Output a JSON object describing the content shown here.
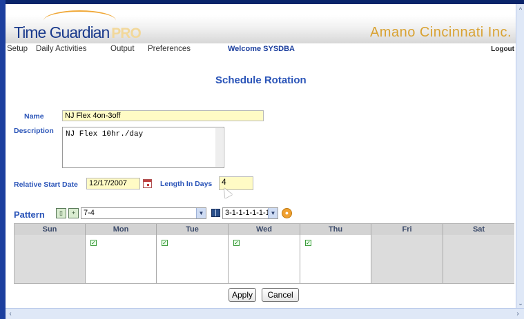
{
  "app": {
    "logo_text": "Time Guardian",
    "logo_suffix": "PRO",
    "company": "Amano Cincinnati Inc."
  },
  "menu": {
    "items": [
      "Setup",
      "Daily Activities",
      "Output",
      "Preferences"
    ],
    "welcome": "Welcome SYSDBA",
    "logout": "Logout"
  },
  "page": {
    "title": "Schedule Rotation"
  },
  "form": {
    "name_label": "Name",
    "name_value": "NJ Flex 4on-3off",
    "description_label": "Description",
    "description_value": "NJ Flex 10hr./day",
    "start_date_label": "Relative Start Date",
    "start_date_value": "12/17/2007",
    "length_label": "Length In Days",
    "length_value": "4"
  },
  "pattern": {
    "label": "Pattern",
    "selected": "7-4",
    "shift_pattern": "3-1-1-1-1-1-1",
    "days": [
      {
        "name": "Sun",
        "checked": false
      },
      {
        "name": "Mon",
        "checked": true
      },
      {
        "name": "Tue",
        "checked": true
      },
      {
        "name": "Wed",
        "checked": true
      },
      {
        "name": "Thu",
        "checked": true
      },
      {
        "name": "Fri",
        "checked": false
      },
      {
        "name": "Sat",
        "checked": false
      }
    ]
  },
  "actions": {
    "apply": "Apply",
    "cancel": "Cancel"
  },
  "icons": {
    "calendar": "calendar-icon",
    "add_pattern": "add-icon",
    "add_user": "add-user-icon",
    "book": "book-icon",
    "orange": "settings-icon"
  },
  "colors": {
    "accent": "#2a54b8",
    "input_highlight": "#fffbc5",
    "brand_gold": "#d9a232"
  }
}
